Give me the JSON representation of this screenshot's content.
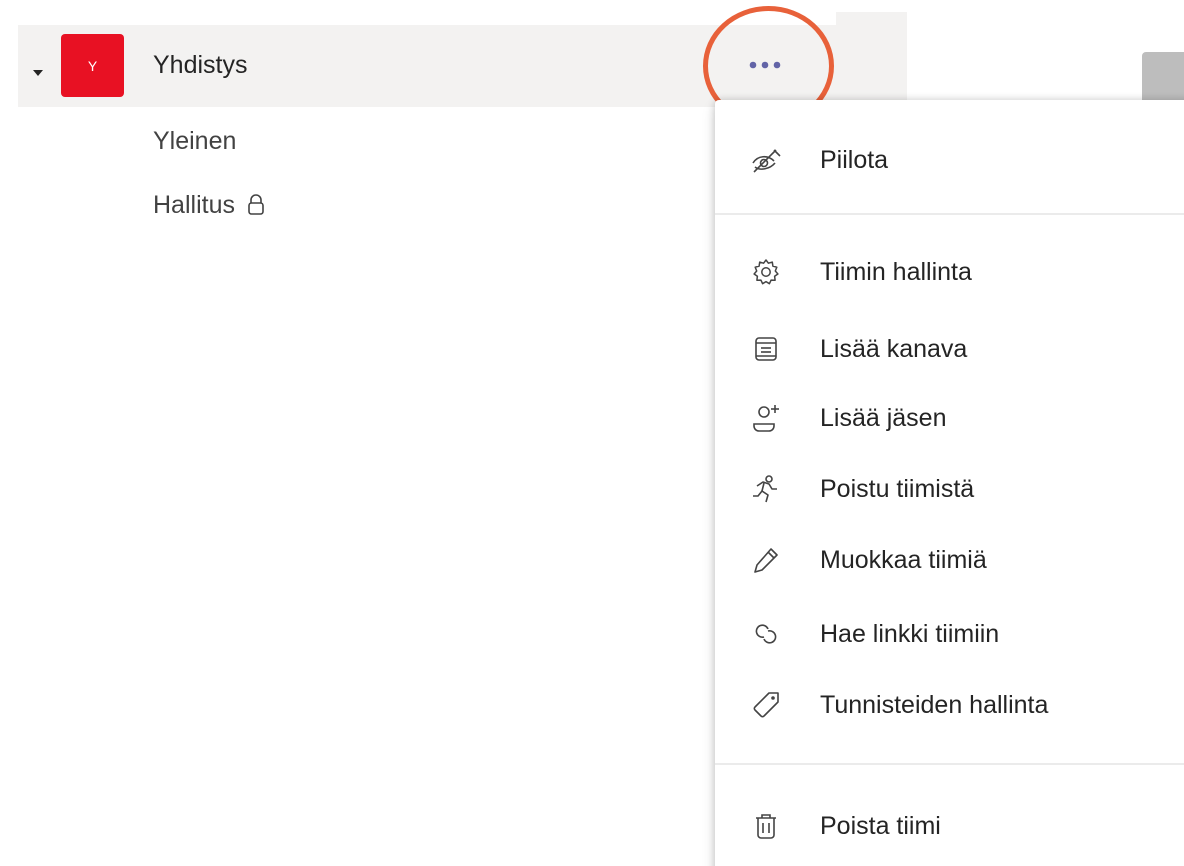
{
  "team": {
    "avatar_letter": "Y",
    "name": "Yhdistys",
    "avatar_color": "#e81123",
    "more_icon": "more-horizontal-icon"
  },
  "channels": [
    {
      "label": "Yleinen"
    },
    {
      "label": "Hallitus",
      "private_icon": "lock-icon"
    }
  ],
  "menu": {
    "items": [
      {
        "label": "Piilota",
        "icon": "eye-off-icon"
      },
      {
        "label": "Tiimin hallinta",
        "icon": "gear-icon"
      },
      {
        "label": "Lisää kanava",
        "icon": "channel-list-icon"
      },
      {
        "label": "Lisää jäsen",
        "icon": "person-add-icon"
      },
      {
        "label": "Poistu tiimistä",
        "icon": "leave-running-icon"
      },
      {
        "label": "Muokkaa tiimiä",
        "icon": "pencil-icon"
      },
      {
        "label": "Hae linkki tiimiin",
        "icon": "link-icon"
      },
      {
        "label": "Tunnisteiden hallinta",
        "icon": "tag-icon"
      },
      {
        "label": "Poista tiimi",
        "icon": "trash-icon"
      }
    ]
  },
  "colors": {
    "accent": "#6264a7",
    "highlight_circle": "#e8613a",
    "row_background": "#f3f2f1"
  }
}
